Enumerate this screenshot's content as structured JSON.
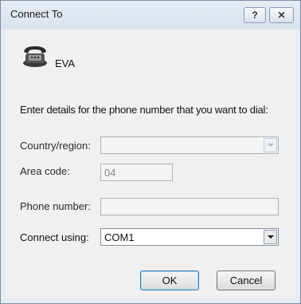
{
  "window": {
    "title": "Connect To",
    "help_button": "?",
    "close_button": "✕"
  },
  "connection": {
    "name": "EVA",
    "icon": "phone-icon"
  },
  "instructions": "Enter details for the phone number that you want to dial:",
  "fields": {
    "country": {
      "label": "Country/region:",
      "value": ""
    },
    "area_code": {
      "label": "Area code:",
      "value": "04"
    },
    "phone": {
      "label": "Phone number:",
      "value": ""
    },
    "connect_using": {
      "label": "Connect using:",
      "value": "COM1"
    }
  },
  "buttons": {
    "ok": "OK",
    "cancel": "Cancel"
  }
}
